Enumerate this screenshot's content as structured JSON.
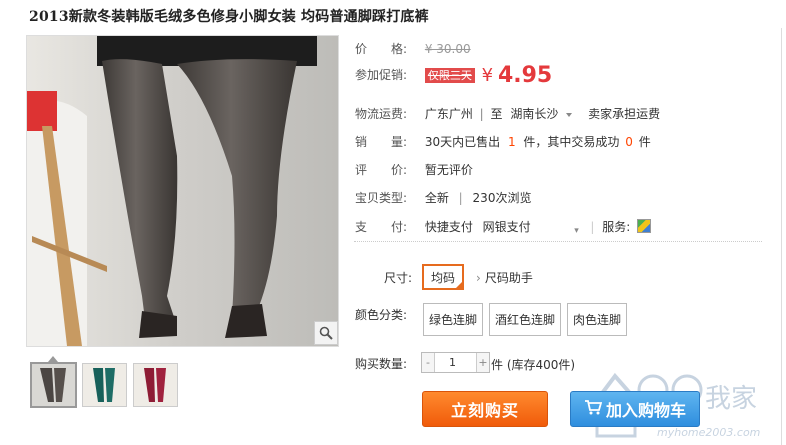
{
  "product": {
    "title": "2013新款冬装韩版毛绒多色修身小脚女装 均码普通脚踩打底裤"
  },
  "attributes": {
    "price_label": "价　　格:",
    "price_original": "¥ 30.00",
    "promo_label": "参加促销:",
    "promo_tag": "仅限三天",
    "promo_yen": "¥",
    "promo_price": "4.95",
    "shipping_label": "物流运费:",
    "shipping_from": "广东广州",
    "shipping_sep": "至",
    "shipping_to": "湖南长沙",
    "shipping_note": "卖家承担运费",
    "sales_label": "销　　量:",
    "sales_prefix": "30天内已售出",
    "sales_count": "1",
    "sales_mid": "件，其中交易成功",
    "sales_success": "0",
    "sales_suffix": "件",
    "review_label": "评　　价:",
    "review_value": "暂无评价",
    "type_label": "宝贝类型:",
    "type_value": "全新",
    "type_sep": "|",
    "views": "230次浏览",
    "pay_label": "支　　付:",
    "pay_quick": "快捷支付",
    "pay_bank": "网银支付",
    "service_label": "服务:"
  },
  "sku": {
    "size_label": "尺寸:",
    "size_option": "均码",
    "size_helper": "尺码助手",
    "color_label": "颜色分类:",
    "color_options": [
      "绿色连脚",
      "酒红色连脚",
      "肉色连脚"
    ],
    "qty_label": "购买数量:",
    "qty_minus": "-",
    "qty_value": "1",
    "qty_plus": "+",
    "qty_stock": "件 (库存400件)"
  },
  "actions": {
    "buy_now": "立刻购买",
    "add_to_cart": "加入购物车"
  },
  "watermark": {
    "text": "我家",
    "site": "myhome2003.com"
  },
  "colors": {
    "price_red": "#e4393c",
    "buy_orange": "#f05b0a",
    "cart_blue": "#2f8ede"
  }
}
